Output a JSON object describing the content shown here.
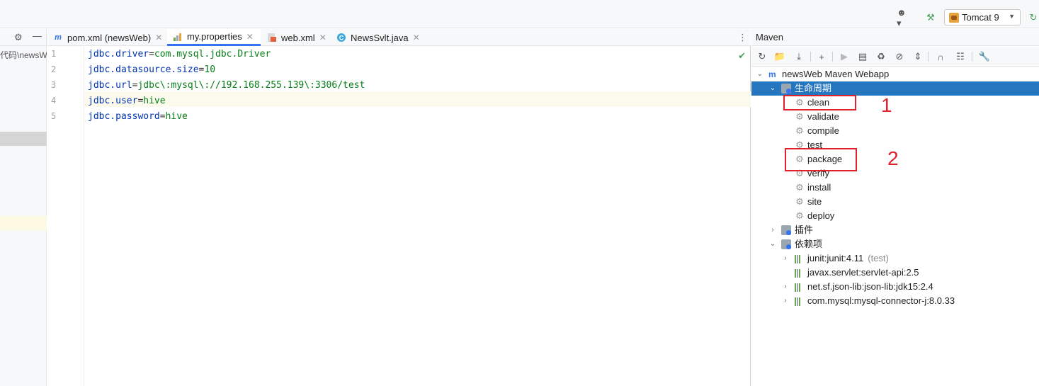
{
  "toolbar": {
    "run_config": "Tomcat 9"
  },
  "project_strip": {
    "path_text": "代码\\newsW"
  },
  "editor": {
    "tabs": [
      {
        "label": "pom.xml (newsWeb)",
        "icon": "m-maven-icon"
      },
      {
        "label": "my.properties",
        "icon": "properties-file-icon"
      },
      {
        "label": "web.xml",
        "icon": "xml-file-icon"
      },
      {
        "label": "NewsSvlt.java",
        "icon": "java-class-icon"
      }
    ],
    "active_tab": "my.properties",
    "line_numbers": [
      "1",
      "2",
      "3",
      "4",
      "5"
    ],
    "lines": [
      {
        "key": "jdbc.driver",
        "eq": "=",
        "value": "com.mysql.jdbc.Driver"
      },
      {
        "key": "jdbc.datasource.size",
        "eq": "=",
        "value": "10"
      },
      {
        "key": "jdbc.url",
        "eq": "=",
        "value": "jdbc\\:mysql\\://192.168.255.139\\:3306/test"
      },
      {
        "key": "jdbc.user",
        "eq": "=",
        "value": "hive"
      },
      {
        "key": "jdbc.password",
        "eq": "=",
        "value": "hive"
      }
    ]
  },
  "maven": {
    "title": "Maven",
    "tree": {
      "project": "newsWeb Maven Webapp",
      "lifecycle": "生命周期",
      "phases": [
        "clean",
        "validate",
        "compile",
        "test",
        "package",
        "verify",
        "install",
        "site",
        "deploy"
      ],
      "plugins": "插件",
      "dependencies_label": "依赖项",
      "dependencies": [
        {
          "name": "junit:junit:4.11",
          "note": "(test)"
        },
        {
          "name": "javax.servlet:servlet-api:2.5",
          "note": ""
        },
        {
          "name": "net.sf.json-lib:json-lib:jdk15:2.4",
          "note": ""
        },
        {
          "name": "com.mysql:mysql-connector-j:8.0.33",
          "note": ""
        }
      ]
    }
  },
  "annotations": {
    "first": "1",
    "second": "2",
    "color": "#e0202a"
  },
  "colors": {
    "selection": "#2675bf",
    "accent": "#3574f0"
  }
}
